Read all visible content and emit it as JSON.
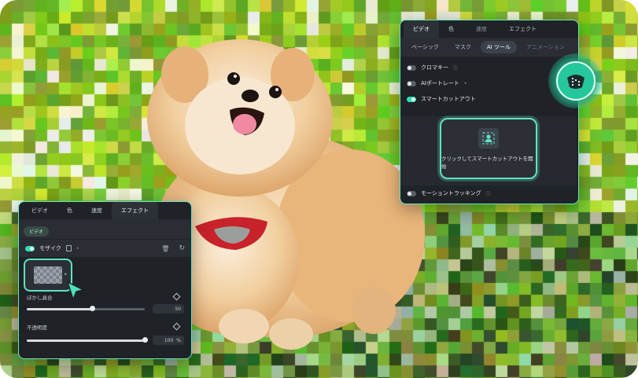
{
  "colors": {
    "accent": "#63e6c3",
    "panel_bg": "#1f2227",
    "toggle_on": "#2ee0b4"
  },
  "right_panel": {
    "tabs": [
      {
        "label": "ビデオ"
      },
      {
        "label": "色"
      },
      {
        "label": "速度"
      },
      {
        "label": "エフェクト"
      }
    ],
    "subtabs": [
      {
        "label": "ベーシック"
      },
      {
        "label": "マスク"
      },
      {
        "label": "AI ツール"
      },
      {
        "label": "アニメーション"
      }
    ],
    "rows": [
      {
        "label": "クロマキー",
        "toggle_on": false
      },
      {
        "label": "AIポートレート",
        "toggle_on": false
      },
      {
        "label": "スマートカットアウト",
        "toggle_on": true
      }
    ],
    "cutout_button_label": "クリックしてスマートカットアウトを開始",
    "motion_tracking_label": "モーショントラッキング"
  },
  "left_panel": {
    "tabs": [
      {
        "label": "ビデオ"
      },
      {
        "label": "色"
      },
      {
        "label": "速度"
      },
      {
        "label": "エフェクト"
      }
    ],
    "chip_label": "ビデオ",
    "mosaic_label": "モザイク",
    "blur": {
      "label": "ぼかし具合",
      "value": "50",
      "fraction": 0.55
    },
    "opacity": {
      "label": "不透明度",
      "value": "100",
      "unit": "%",
      "fraction": 1.0
    }
  },
  "icons": [
    "help-icon",
    "trash-icon",
    "reset-icon",
    "diamond-keyframe-icon",
    "person-icon",
    "cursor-icon",
    "app-logo-icon"
  ]
}
